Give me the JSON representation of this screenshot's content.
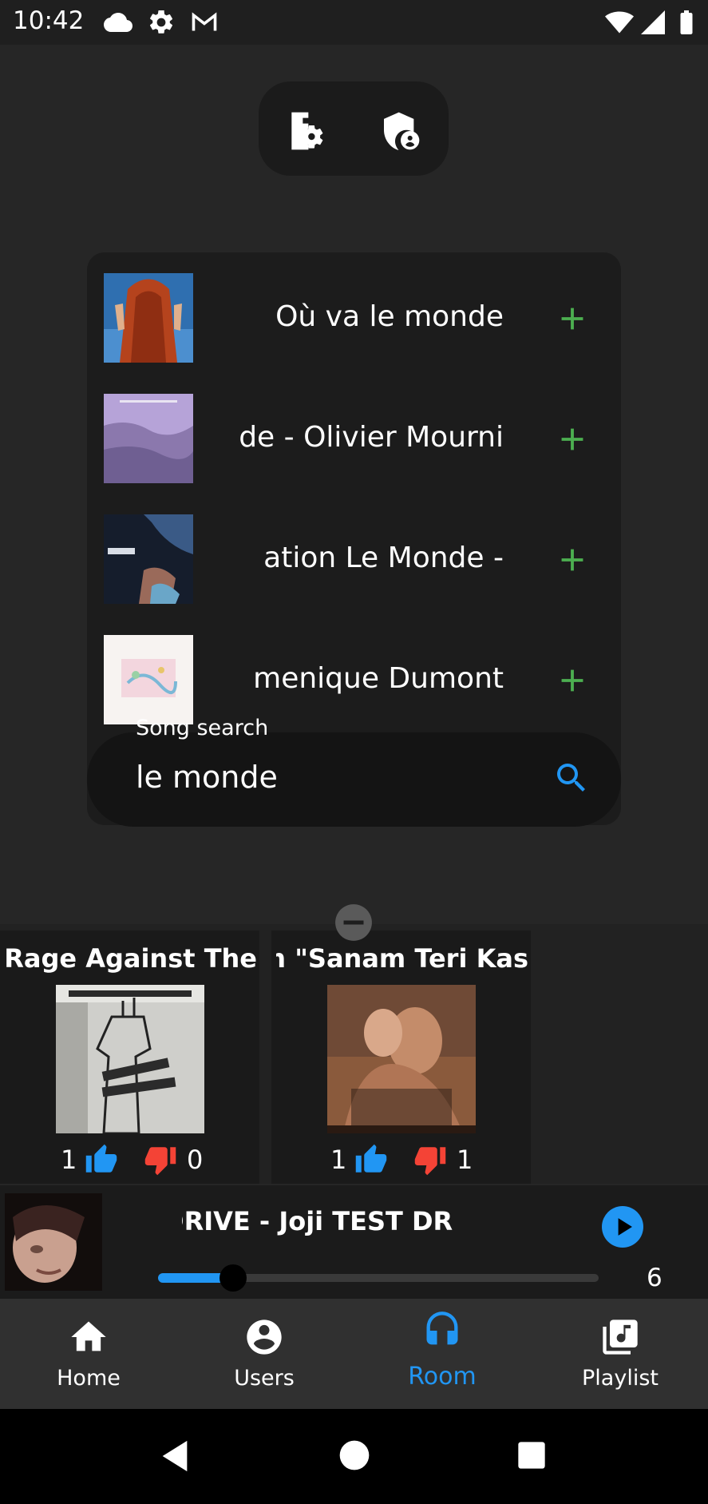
{
  "status_bar": {
    "time": "10:42",
    "left_icons": [
      "cloud-icon",
      "settings-gear-icon",
      "gmail-icon"
    ],
    "right_icons": [
      "wifi-icon",
      "cellular-signal-icon",
      "battery-icon"
    ]
  },
  "admin_actions": {
    "icons": [
      "room-settings-icon",
      "admin-shield-icon"
    ]
  },
  "search": {
    "label": "Song search",
    "query": "le monde",
    "results": [
      {
        "title": "Où va le monde",
        "action_icon": "add-icon"
      },
      {
        "title": "de - Olivier Mourni",
        "action_icon": "add-icon"
      },
      {
        "title": "ation      Le Monde -",
        "action_icon": "add-icon"
      },
      {
        "title": "menique Dumont",
        "action_icon": "add-icon"
      }
    ],
    "accent_color": "#4caf50",
    "search_icon_color": "#2196f3"
  },
  "queue": {
    "items": [
      {
        "title": "/ - Rage Against The",
        "likes": "1",
        "dislikes": "0"
      },
      {
        "title": "om \"Sanam Teri Kas",
        "likes": "1",
        "dislikes": "1"
      }
    ],
    "like_color": "#2196f3",
    "dislike_color": "#f44336"
  },
  "now_playing": {
    "title": "ST DRIVE - Joji      TEST DR",
    "progress_fraction": 0.17,
    "count": "6"
  },
  "bottom_nav": {
    "items": [
      {
        "label": "Home",
        "icon": "home-icon",
        "active": false
      },
      {
        "label": "Users",
        "icon": "user-account-icon",
        "active": false
      },
      {
        "label": "Room",
        "icon": "headphones-icon",
        "active": true
      },
      {
        "label": "Playlist",
        "icon": "playlist-icon",
        "active": false
      }
    ],
    "active_color": "#2196f3"
  },
  "system_nav": {
    "icons": [
      "back-icon",
      "home-circle-icon",
      "recents-icon"
    ]
  }
}
